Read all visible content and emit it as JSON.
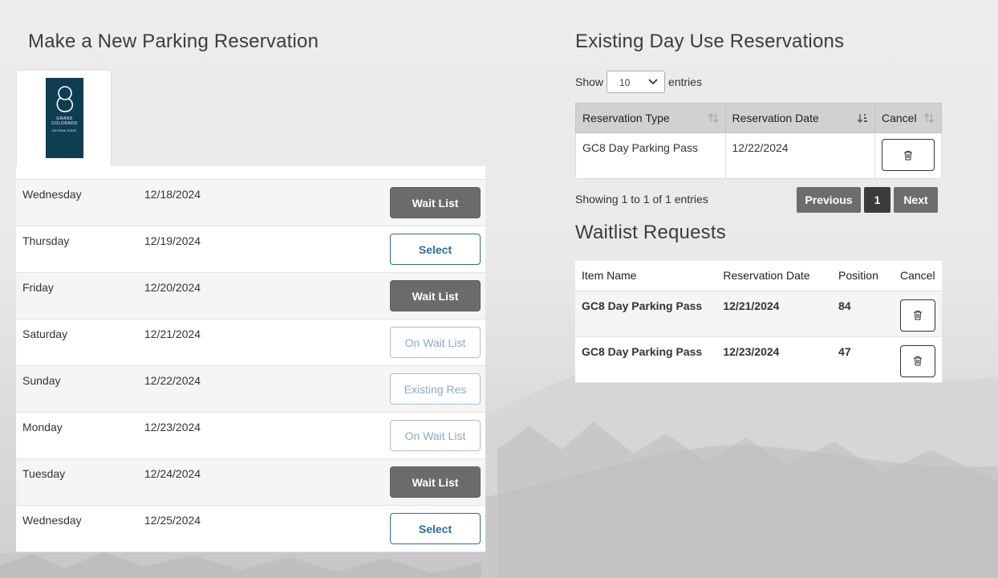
{
  "left": {
    "title": "Make a New Parking Reservation",
    "logo": {
      "line1": "GRAND",
      "line2": "COLORADO",
      "line3": "ON PEAK EIGHT"
    },
    "days": [
      {
        "day": "Wednesday",
        "date": "12/18/2024",
        "action": "Wait List",
        "style": "wait"
      },
      {
        "day": "Thursday",
        "date": "12/19/2024",
        "action": "Select",
        "style": "select"
      },
      {
        "day": "Friday",
        "date": "12/20/2024",
        "action": "Wait List",
        "style": "wait"
      },
      {
        "day": "Saturday",
        "date": "12/21/2024",
        "action": "On Wait List",
        "style": "disabled"
      },
      {
        "day": "Sunday",
        "date": "12/22/2024",
        "action": "Existing Res",
        "style": "disabled"
      },
      {
        "day": "Monday",
        "date": "12/23/2024",
        "action": "On Wait List",
        "style": "disabled"
      },
      {
        "day": "Tuesday",
        "date": "12/24/2024",
        "action": "Wait List",
        "style": "wait"
      },
      {
        "day": "Wednesday",
        "date": "12/25/2024",
        "action": "Select",
        "style": "select"
      }
    ]
  },
  "right": {
    "title": "Existing Day Use Reservations",
    "show_label": "Show",
    "entries_label": "entries",
    "page_length": "10",
    "columns": [
      "Reservation Type",
      "Reservation Date",
      "Cancel"
    ],
    "rows": [
      {
        "type": "GC8 Day Parking Pass",
        "date": "12/22/2024"
      }
    ],
    "info": "Showing 1 to 1 of 1 entries",
    "pager": {
      "prev": "Previous",
      "current": "1",
      "next": "Next"
    }
  },
  "waitlist": {
    "title": "Waitlist Requests",
    "columns": [
      "Item Name",
      "Reservation Date",
      "Position",
      "Cancel"
    ],
    "rows": [
      {
        "item": "GC8 Day Parking Pass",
        "date": "12/21/2024",
        "position": "84"
      },
      {
        "item": "GC8 Day Parking Pass",
        "date": "12/23/2024",
        "position": "47"
      }
    ]
  },
  "colors": {
    "wait_button": "#6b6b6b",
    "select_button_border": "#2f6b9a",
    "logo_background": "#0f3d52",
    "table_header": "#d1d1d1"
  },
  "icons": {
    "trash": "trash-icon",
    "sort": "sort-icon",
    "dropdown": "chevron-down-icon"
  }
}
